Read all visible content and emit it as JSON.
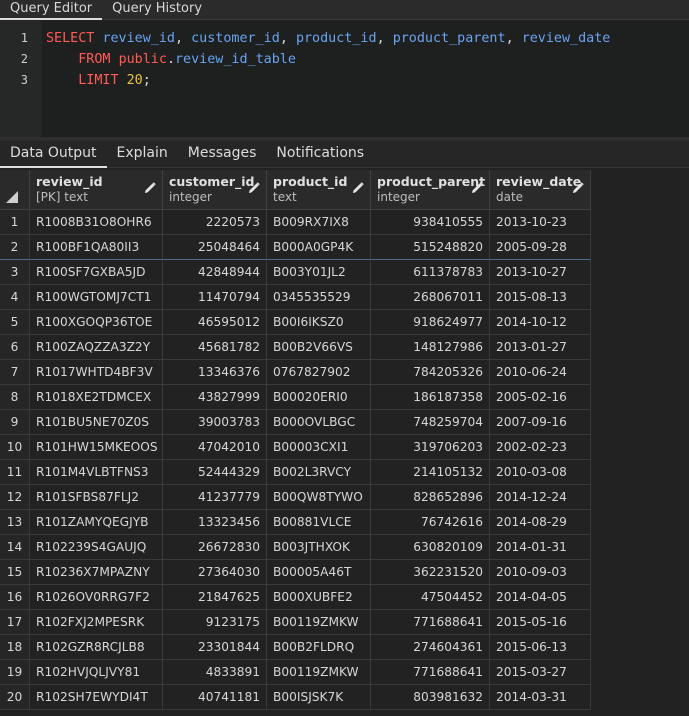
{
  "top_tabs": [
    {
      "label": "Query Editor",
      "active": true
    },
    {
      "label": "Query History",
      "active": false
    }
  ],
  "editor": {
    "lines": [
      {
        "num": "1",
        "tokens": [
          {
            "t": "SELECT",
            "c": "kw"
          },
          {
            "t": " ",
            "c": "plain"
          },
          {
            "t": "review_id",
            "c": "id"
          },
          {
            "t": ", ",
            "c": "plain"
          },
          {
            "t": "customer_id",
            "c": "id"
          },
          {
            "t": ", ",
            "c": "plain"
          },
          {
            "t": "product_id",
            "c": "id"
          },
          {
            "t": ", ",
            "c": "plain"
          },
          {
            "t": "product_parent",
            "c": "id"
          },
          {
            "t": ", ",
            "c": "plain"
          },
          {
            "t": "review_date",
            "c": "id"
          }
        ]
      },
      {
        "num": "2",
        "tokens": [
          {
            "t": "    FROM",
            "c": "kw"
          },
          {
            "t": " ",
            "c": "plain"
          },
          {
            "t": "public",
            "c": "kw"
          },
          {
            "t": ".",
            "c": "plain"
          },
          {
            "t": "review_id_table",
            "c": "id"
          }
        ]
      },
      {
        "num": "3",
        "tokens": [
          {
            "t": "    LIMIT",
            "c": "kw"
          },
          {
            "t": " ",
            "c": "plain"
          },
          {
            "t": "20",
            "c": "num"
          },
          {
            "t": ";",
            "c": "plain"
          }
        ]
      }
    ]
  },
  "bottom_tabs": [
    {
      "label": "Data Output",
      "active": true
    },
    {
      "label": "Explain",
      "active": false
    },
    {
      "label": "Messages",
      "active": false
    },
    {
      "label": "Notifications",
      "active": false
    }
  ],
  "grid": {
    "columns": [
      {
        "name": "review_id",
        "type": "[PK] text",
        "align": "left"
      },
      {
        "name": "customer_id",
        "type": "integer",
        "align": "right"
      },
      {
        "name": "product_id",
        "type": "text",
        "align": "left"
      },
      {
        "name": "product_parent",
        "type": "integer",
        "align": "right"
      },
      {
        "name": "review_date",
        "type": "date",
        "align": "left"
      }
    ],
    "rows": [
      [
        "1",
        "R1008B31O8OHR6",
        "2220573",
        "B009RX7IX8",
        "938410555",
        "2013-10-23"
      ],
      [
        "2",
        "R100BF1QA80II3",
        "25048464",
        "B000A0GP4K",
        "515248820",
        "2005-09-28"
      ],
      [
        "3",
        "R100SF7GXBA5JD",
        "42848944",
        "B003Y01JL2",
        "611378783",
        "2013-10-27"
      ],
      [
        "4",
        "R100WGTOMJ7CT1",
        "11470794",
        "0345535529",
        "268067011",
        "2015-08-13"
      ],
      [
        "5",
        "R100XGOQP36TOE",
        "46595012",
        "B00I6IKSZ0",
        "918624977",
        "2014-10-12"
      ],
      [
        "6",
        "R100ZAQZZA3Z2Y",
        "45681782",
        "B00B2V66VS",
        "148127986",
        "2013-01-27"
      ],
      [
        "7",
        "R1017WHTD4BF3V",
        "13346376",
        "0767827902",
        "784205326",
        "2010-06-24"
      ],
      [
        "8",
        "R1018XE2TDMCEX",
        "43827999",
        "B00020ERI0",
        "186187358",
        "2005-02-16"
      ],
      [
        "9",
        "R101BU5NE70Z0S",
        "39003783",
        "B000OVLBGC",
        "748259704",
        "2007-09-16"
      ],
      [
        "10",
        "R101HW15MKEOOS",
        "47042010",
        "B00003CXI1",
        "319706203",
        "2002-02-23"
      ],
      [
        "11",
        "R101M4VLBTFNS3",
        "52444329",
        "B002L3RVCY",
        "214105132",
        "2010-03-08"
      ],
      [
        "12",
        "R101SFBS87FLJ2",
        "41237779",
        "B00QW8TYWO",
        "828652896",
        "2014-12-24"
      ],
      [
        "13",
        "R101ZAMYQEGJYB",
        "13323456",
        "B00881VLCE",
        "76742616",
        "2014-08-29"
      ],
      [
        "14",
        "R102239S4GAUJQ",
        "26672830",
        "B003JTHXOK",
        "630820109",
        "2014-01-31"
      ],
      [
        "15",
        "R10236X7MPAZNY",
        "27364030",
        "B00005A46T",
        "362231520",
        "2010-09-03"
      ],
      [
        "16",
        "R1026OV0RRG7F2",
        "21847625",
        "B000XUBFE2",
        "47504452",
        "2014-04-05"
      ],
      [
        "17",
        "R102FXJ2MPESRK",
        "9123175",
        "B00119ZMKW",
        "771688641",
        "2015-05-16"
      ],
      [
        "18",
        "R102GZR8RCJLB8",
        "23301844",
        "B00B2FLDRQ",
        "274604361",
        "2015-06-13"
      ],
      [
        "19",
        "R102HVJQLJVY81",
        "4833891",
        "B00119ZMKW",
        "771688641",
        "2015-03-27"
      ],
      [
        "20",
        "R102SH7EWYDI4T",
        "40741181",
        "B00ISJSK7K",
        "803981632",
        "2014-03-31"
      ]
    ]
  },
  "colors": {
    "keyword": "#ff5c57",
    "identifier": "#69a4f0",
    "number": "#e8c04a",
    "background": "#222222"
  }
}
